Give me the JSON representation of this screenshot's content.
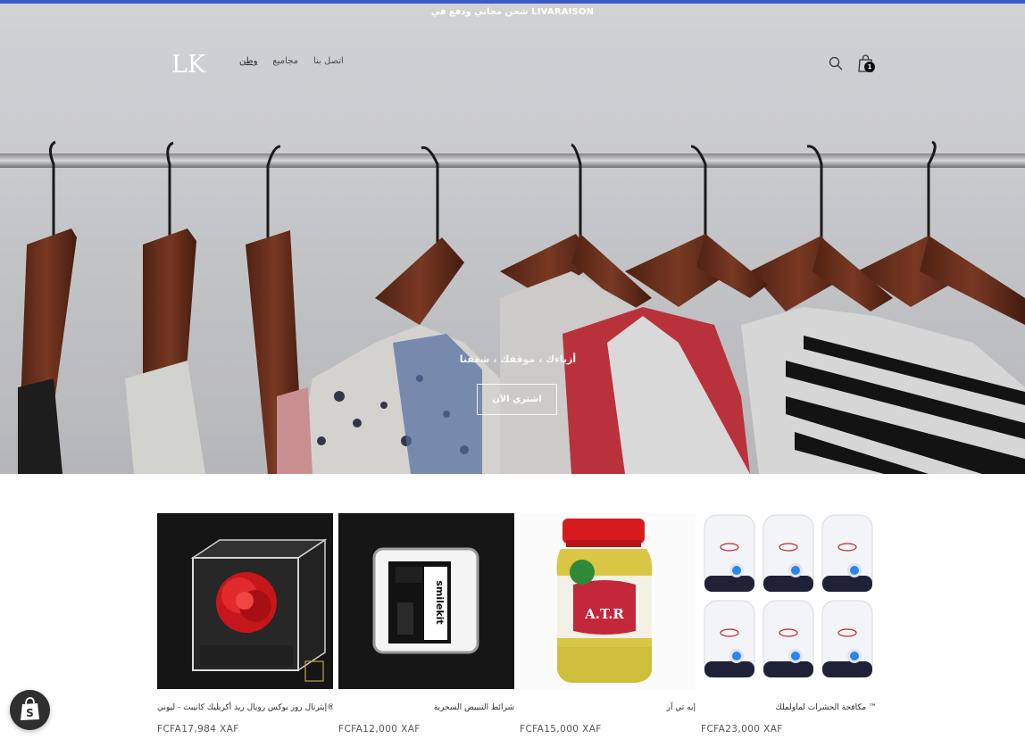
{
  "announcement": "شحن مجاني ودفع في LIVARAISON",
  "brand": {
    "logo_text": "LK"
  },
  "nav": {
    "items": [
      {
        "label": "وطن",
        "active": true
      },
      {
        "label": "مجاميع",
        "active": false
      },
      {
        "label": "اتصل بنا",
        "active": false
      }
    ]
  },
  "header": {
    "search_icon": "search-icon",
    "cart_icon": "shopping-bag-icon",
    "cart_count": "1"
  },
  "hero": {
    "caption": "أزياءك ، موقفك ، شغفنا",
    "button_label": "اشتري الآن"
  },
  "products": [
    {
      "title": "إيترنال روز بوكس رويال ريد أكريليك كانيبت - ليوني®",
      "price": "FCFA17,984 XAF"
    },
    {
      "title": "شرائط التبييض السحرية",
      "price": "FCFA12,000 XAF"
    },
    {
      "title": "إيه تي آر",
      "price": "FCFA15,000 XAF"
    },
    {
      "title": "مكافحة الحشرات لماولملك ™",
      "price": "FCFA23,000 XAF"
    }
  ],
  "colors": {
    "accent_bar": "#3a5bc7",
    "shop_badge": "#2f2f2f"
  }
}
